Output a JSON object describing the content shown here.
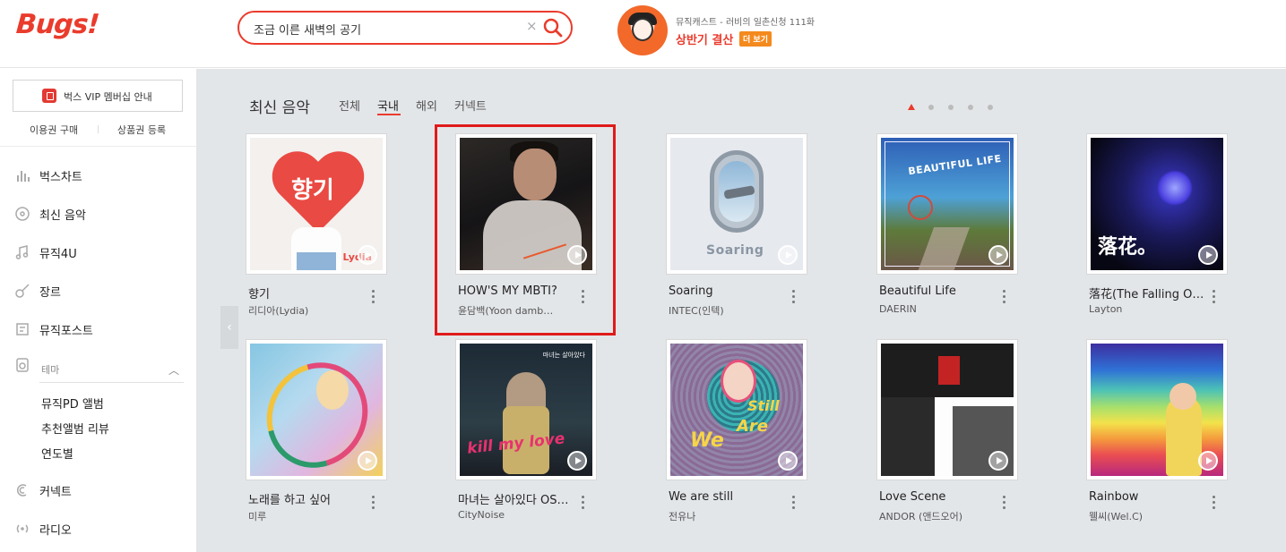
{
  "header": {
    "logo": "Bugs!",
    "search": {
      "value": "조금 이른 새벽의 공기",
      "clear": "×"
    },
    "promo": {
      "subtitle": "뮤직캐스트 - 러비의 일촌신청 111화",
      "title": "상반기 결산",
      "more": "더 보기"
    }
  },
  "sidebar": {
    "vip_button": "벅스 VIP 멤버십 안내",
    "sublinks": [
      "이용권 구매",
      "상품권 등록"
    ],
    "nav": [
      {
        "label": "벅스차트",
        "icon": "chart-bars-icon"
      },
      {
        "label": "최신 음악",
        "icon": "disc-new-icon"
      },
      {
        "label": "뮤직4U",
        "icon": "music-note-icon"
      },
      {
        "label": "장르",
        "icon": "guitar-icon"
      },
      {
        "label": "뮤직포스트",
        "icon": "post-icon"
      }
    ],
    "theme": {
      "label": "테마",
      "items": [
        "뮤직PD 앨범",
        "추천앨범 리뷰",
        "연도별"
      ]
    },
    "nav_bottom": [
      {
        "label": "커넥트",
        "icon": "connect-icon"
      },
      {
        "label": "라디오",
        "icon": "radio-icon"
      }
    ]
  },
  "main": {
    "title": "최신 음악",
    "tabs": [
      {
        "label": "전체",
        "active": false
      },
      {
        "label": "국내",
        "active": true
      },
      {
        "label": "해외",
        "active": false
      },
      {
        "label": "커넥트",
        "active": false
      }
    ],
    "pager": {
      "pages": 5,
      "current": 1
    },
    "albums": [
      {
        "title": "향기",
        "artist": "리디아(Lydia)",
        "cover_text": "향기",
        "cover_sub": "Lydia"
      },
      {
        "title": "HOW'S MY MBTI?",
        "artist": "윤담백(Yoon damb…"
      },
      {
        "title": "Soaring",
        "artist": "INTEC(인텍)",
        "cover_text": "Soaring"
      },
      {
        "title": "Beautiful Life",
        "artist": "DAERIN",
        "cover_text": "BEAUTIFUL LIFE"
      },
      {
        "title": "落花(The Falling Of …",
        "artist": "Layton",
        "cover_text": "落花。"
      },
      {
        "title": "노래를 하고 싶어",
        "artist": "미루"
      },
      {
        "title": "마녀는 살아있다 OST …",
        "artist": "CityNoise",
        "cover_text": "kill my love",
        "cover_tag": "마녀는 살아있다"
      },
      {
        "title": "We are still",
        "artist": "전유나",
        "cover_text": [
          "We",
          "Are",
          "Still"
        ]
      },
      {
        "title": "Love Scene",
        "artist": "ANDOR (앤드오어)"
      },
      {
        "title": "Rainbow",
        "artist": "웰씨(Wel.C)"
      }
    ],
    "highlighted_album": "HOW'S MY MBTI?"
  },
  "colors": {
    "brand": "#ea3b2c",
    "background": "#e3e6e9",
    "highlight": "#e01a1a"
  }
}
